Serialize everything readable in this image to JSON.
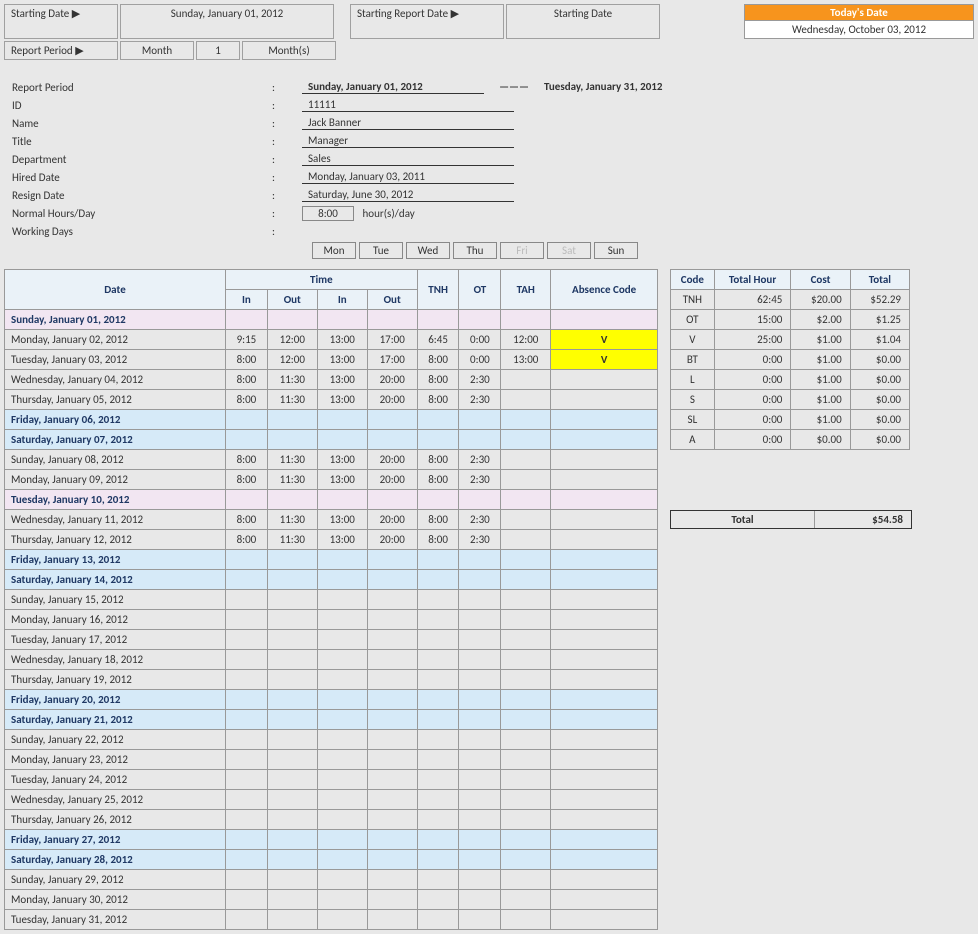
{
  "top": {
    "starting_date_label": "Starting Date ▶",
    "starting_date_value": "Sunday, January 01, 2012",
    "starting_report_label": "Starting Report Date ▶",
    "starting_report_value": "Starting Date",
    "report_period_label": "Report Period ▶",
    "report_period_unit": "Month",
    "report_period_qty": "1",
    "report_period_suffix": "Month(s)",
    "today_label": "Today's Date",
    "today_value": "Wednesday, October 03, 2012"
  },
  "info": {
    "report_period_label": "Report Period",
    "report_period_from": "Sunday, January 01, 2012",
    "report_period_to": "Tuesday, January 31, 2012",
    "id_label": "ID",
    "id_value": "11111",
    "name_label": "Name",
    "name_value": "Jack Banner",
    "title_label": "Title",
    "title_value": "Manager",
    "dept_label": "Department",
    "dept_value": "Sales",
    "hired_label": "Hired Date",
    "hired_value": "Monday, January 03, 2011",
    "resign_label": "Resign Date",
    "resign_value": "Saturday, June 30, 2012",
    "hours_label": "Normal Hours/Day",
    "hours_value": "8:00",
    "hours_suffix": "hour(s)/day",
    "working_label": "Working Days",
    "days": [
      "Mon",
      "Tue",
      "Wed",
      "Thu",
      "Fri",
      "Sat",
      "Sun"
    ],
    "days_off": [
      false,
      false,
      false,
      false,
      true,
      true,
      false
    ]
  },
  "headers": {
    "date": "Date",
    "time": "Time",
    "in": "In",
    "out": "Out",
    "tnh": "TNH",
    "ot": "OT",
    "tah": "TAH",
    "absence": "Absence Code"
  },
  "rows": [
    {
      "date": "Sunday, January 01, 2012",
      "cls": "row-sun"
    },
    {
      "date": "Monday, January 02, 2012",
      "in1": "9:15",
      "out1": "12:00",
      "in2": "13:00",
      "out2": "17:00",
      "tnh": "6:45",
      "ot": "0:00",
      "tah": "12:00",
      "abs": "V",
      "abscls": "abs-v"
    },
    {
      "date": "Tuesday, January 03, 2012",
      "in1": "8:00",
      "out1": "12:00",
      "in2": "13:00",
      "out2": "17:00",
      "tnh": "8:00",
      "ot": "0:00",
      "tah": "13:00",
      "abs": "V",
      "abscls": "abs-v"
    },
    {
      "date": "Wednesday, January 04, 2012",
      "in1": "8:00",
      "out1": "11:30",
      "in2": "13:00",
      "out2": "20:00",
      "tnh": "8:00",
      "ot": "2:30"
    },
    {
      "date": "Thursday, January 05, 2012",
      "in1": "8:00",
      "out1": "11:30",
      "in2": "13:00",
      "out2": "20:00",
      "tnh": "8:00",
      "ot": "2:30"
    },
    {
      "date": "Friday, January 06, 2012",
      "cls": "row-fri"
    },
    {
      "date": "Saturday, January 07, 2012",
      "cls": "row-sat"
    },
    {
      "date": "Sunday, January 08, 2012",
      "in1": "8:00",
      "out1": "11:30",
      "in2": "13:00",
      "out2": "20:00",
      "tnh": "8:00",
      "ot": "2:30"
    },
    {
      "date": "Monday, January 09, 2012",
      "in1": "8:00",
      "out1": "11:30",
      "in2": "13:00",
      "out2": "20:00",
      "tnh": "8:00",
      "ot": "2:30"
    },
    {
      "date": "Tuesday, January 10, 2012",
      "cls": "row-tue-hol"
    },
    {
      "date": "Wednesday, January 11, 2012",
      "in1": "8:00",
      "out1": "11:30",
      "in2": "13:00",
      "out2": "20:00",
      "tnh": "8:00",
      "ot": "2:30"
    },
    {
      "date": "Thursday, January 12, 2012",
      "in1": "8:00",
      "out1": "11:30",
      "in2": "13:00",
      "out2": "20:00",
      "tnh": "8:00",
      "ot": "2:30"
    },
    {
      "date": "Friday, January 13, 2012",
      "cls": "row-fri"
    },
    {
      "date": "Saturday, January 14, 2012",
      "cls": "row-sat"
    },
    {
      "date": "Sunday, January 15, 2012"
    },
    {
      "date": "Monday, January 16, 2012"
    },
    {
      "date": "Tuesday, January 17, 2012"
    },
    {
      "date": "Wednesday, January 18, 2012"
    },
    {
      "date": "Thursday, January 19, 2012"
    },
    {
      "date": "Friday, January 20, 2012",
      "cls": "row-fri"
    },
    {
      "date": "Saturday, January 21, 2012",
      "cls": "row-sat"
    },
    {
      "date": "Sunday, January 22, 2012"
    },
    {
      "date": "Monday, January 23, 2012"
    },
    {
      "date": "Tuesday, January 24, 2012"
    },
    {
      "date": "Wednesday, January 25, 2012"
    },
    {
      "date": "Thursday, January 26, 2012"
    },
    {
      "date": "Friday, January 27, 2012",
      "cls": "row-fri"
    },
    {
      "date": "Saturday, January 28, 2012",
      "cls": "row-sat"
    },
    {
      "date": "Sunday, January 29, 2012"
    },
    {
      "date": "Monday, January 30, 2012"
    },
    {
      "date": "Tuesday, January 31, 2012"
    }
  ],
  "summary_headers": {
    "code": "Code",
    "hour": "Total Hour",
    "cost": "Cost",
    "total": "Total"
  },
  "summary": [
    {
      "code": "TNH",
      "hour": "62:45",
      "cost": "$20.00",
      "total": "$52.29"
    },
    {
      "code": "OT",
      "hour": "15:00",
      "cost": "$2.00",
      "total": "$1.25"
    },
    {
      "code": "V",
      "hour": "25:00",
      "cost": "$1.00",
      "total": "$1.04"
    },
    {
      "code": "BT",
      "hour": "0:00",
      "cost": "$1.00",
      "total": "$0.00"
    },
    {
      "code": "L",
      "hour": "0:00",
      "cost": "$1.00",
      "total": "$0.00"
    },
    {
      "code": "S",
      "hour": "0:00",
      "cost": "$1.00",
      "total": "$0.00"
    },
    {
      "code": "SL",
      "hour": "0:00",
      "cost": "$1.00",
      "total": "$0.00"
    },
    {
      "code": "A",
      "hour": "0:00",
      "cost": "$0.00",
      "total": "$0.00"
    }
  ],
  "grand_total": {
    "label": "Total",
    "value": "$54.58"
  }
}
